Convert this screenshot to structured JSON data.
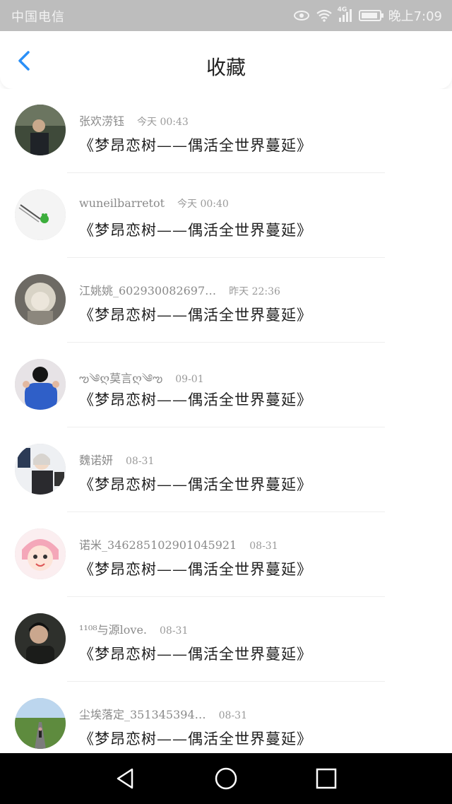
{
  "status_bar": {
    "carrier": "中国电信",
    "network": "4G",
    "time": "晚上7:09"
  },
  "header": {
    "title": "收藏",
    "back_icon": "chevron-left-icon",
    "accent_color": "#2a8ff7"
  },
  "items": [
    {
      "username": "张欢涝钰",
      "time": "今天 00:43",
      "title": "《梦昂恋树——偶活全世界蔓延》"
    },
    {
      "username": "wuneilbarretot",
      "time": "今天 00:40",
      "title": "《梦昂恋树——偶活全世界蔓延》"
    },
    {
      "username": "江姚姚_602930082697…",
      "time": "昨天 22:36",
      "title": "《梦昂恋树——偶活全世界蔓延》"
    },
    {
      "username": "ఌ༄ღ莫言ღ༄ఌ",
      "time": "09-01",
      "title": "《梦昂恋树——偶活全世界蔓延》"
    },
    {
      "username": "魏诺妍",
      "time": "08-31",
      "title": "《梦昂恋树——偶活全世界蔓延》"
    },
    {
      "username": "诺米_346285102901045921",
      "time": "08-31",
      "title": "《梦昂恋树——偶活全世界蔓延》"
    },
    {
      "username": "¹¹⁰⁸与源love.",
      "time": "08-31",
      "title": "《梦昂恋树——偶活全世界蔓延》"
    },
    {
      "username": "尘埃落定_351345394…",
      "time": "08-31",
      "title": "《梦昂恋树——偶活全世界蔓延》"
    }
  ],
  "system_nav": {
    "back_icon": "triangle-back-icon",
    "home_icon": "circle-home-icon",
    "recent_icon": "square-recent-icon"
  }
}
